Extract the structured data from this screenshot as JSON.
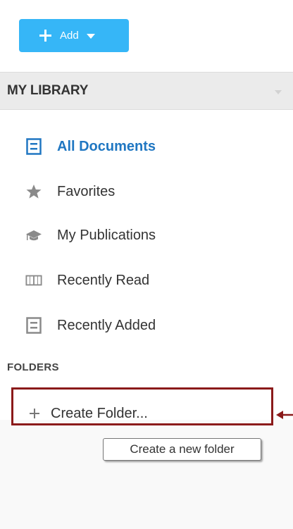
{
  "toolbar": {
    "add_label": "Add"
  },
  "library": {
    "title": "MY LIBRARY",
    "items": [
      {
        "label": "All Documents",
        "icon": "document-icon",
        "active": true
      },
      {
        "label": "Favorites",
        "icon": "star-icon",
        "active": false
      },
      {
        "label": "My Publications",
        "icon": "graduation-cap-icon",
        "active": false
      },
      {
        "label": "Recently Read",
        "icon": "open-book-icon",
        "active": false
      },
      {
        "label": "Recently Added",
        "icon": "document-icon",
        "active": false
      }
    ]
  },
  "folders": {
    "title": "FOLDERS",
    "create_label": "Create Folder...",
    "tooltip": "Create a new folder"
  },
  "colors": {
    "accent_blue": "#36b6f7",
    "active_link": "#2077c2",
    "highlight_border": "#8b1a1a",
    "icon_gray": "#8a8a8a"
  }
}
